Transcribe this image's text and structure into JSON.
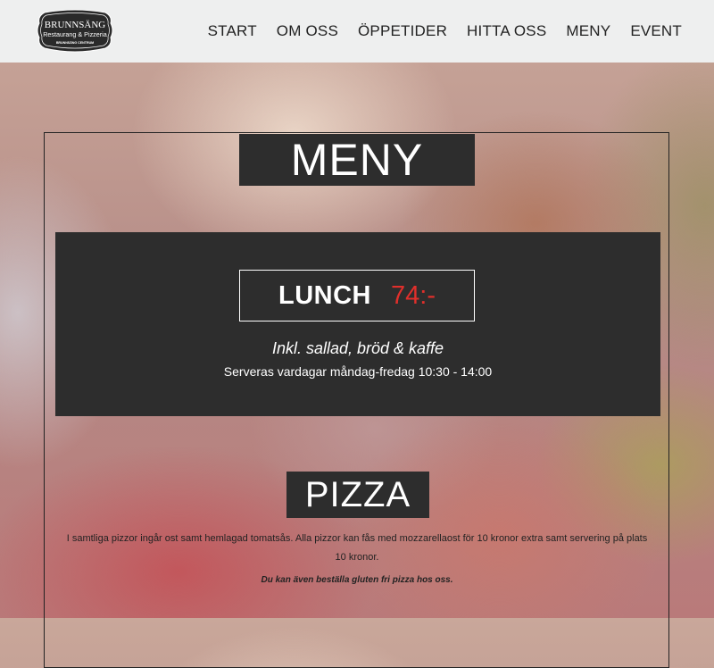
{
  "header": {
    "logo": {
      "name": "BRUNNSÄNG",
      "tagline": "Restaurang & Pizzeria",
      "location": "BRUNNSÄNG CENTRUM"
    },
    "nav": [
      "START",
      "OM OSS",
      "ÖPPETIDER",
      "HITTA OSS",
      "MENY",
      "EVENT"
    ]
  },
  "menu": {
    "title": "MENY",
    "lunch": {
      "label": "LUNCH",
      "price": "74:-",
      "price_color": "#e02f2b",
      "includes": "Inkl. sallad, bröd & kaffe",
      "hours": "Serveras vardagar måndag-fredag 10:30 - 14:00"
    },
    "pizza": {
      "title": "PIZZA",
      "description": "I samtliga pizzor ingår ost samt hemlagad tomatsås. Alla pizzor kan fås med mozzarellaost för 10 kronor extra samt servering på plats 10 kronor.",
      "gluten_note": "Du kan även beställa gluten fri pizza hos oss."
    }
  },
  "colors": {
    "header_bg": "#eeefef",
    "panel_bg": "#2d2d2d"
  }
}
